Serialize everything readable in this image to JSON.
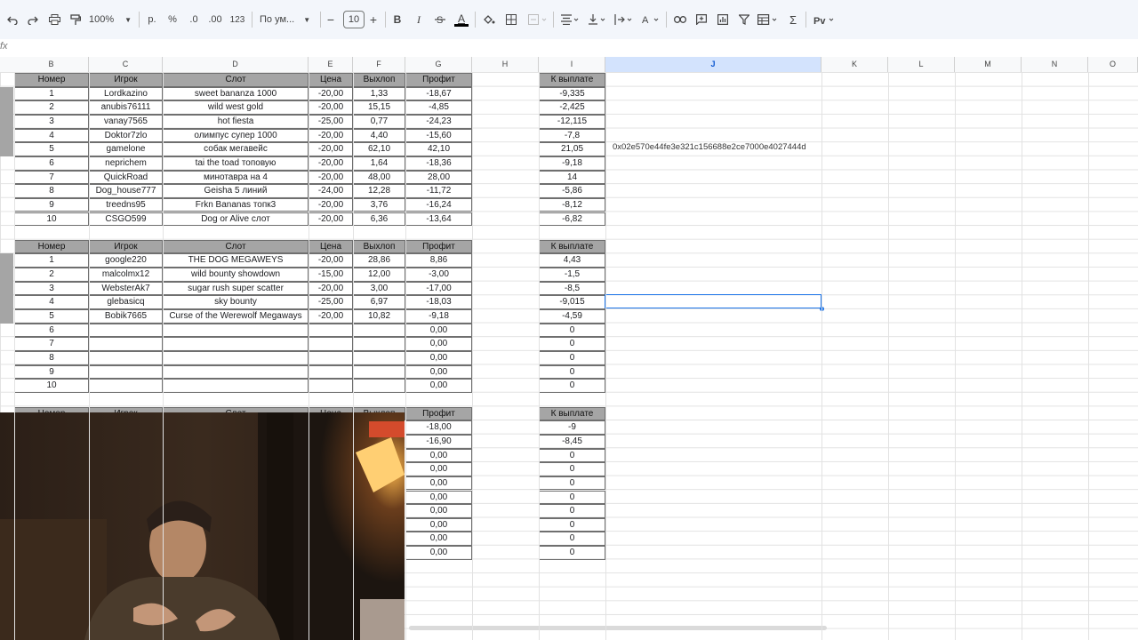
{
  "toolbar": {
    "zoom": "100%",
    "currency": "р.",
    "percent": "%",
    "dec_decrease": ".0",
    "dec_increase": ".00",
    "number_format": "123",
    "font": "По ум...",
    "font_size": "10",
    "minus": "−",
    "plus": "+",
    "bold": "B",
    "italic": "I",
    "text_color_letter": "A"
  },
  "formula_bar": {
    "fx": "fx",
    "value": ""
  },
  "columns": [
    "B",
    "C",
    "D",
    "E",
    "F",
    "G",
    "H",
    "I",
    "J",
    "K",
    "L",
    "M",
    "N",
    "O"
  ],
  "selected_column": "J",
  "wallet_address": "0x02e570e44fe3e321c156688e2ce7000e4027444d",
  "headers": {
    "num": "Номер",
    "player": "Игрок",
    "slot": "Слот",
    "price": "Цена",
    "payout": "Выхлоп",
    "profit": "Профит",
    "to_pay": "К выплате"
  },
  "table1": [
    {
      "n": "1",
      "player": "Lordkazino",
      "slot": "sweet bananza 1000",
      "price": "-20,00",
      "payout": "1,33",
      "profit": "-18,67",
      "pay": "-9,335"
    },
    {
      "n": "2",
      "player": "anubis76111",
      "slot": "wild west gold",
      "price": "-20,00",
      "payout": "15,15",
      "profit": "-4,85",
      "pay": "-2,425"
    },
    {
      "n": "3",
      "player": "vanay7565",
      "slot": "hot fiesta",
      "price": "-25,00",
      "payout": "0,77",
      "profit": "-24,23",
      "pay": "-12,115"
    },
    {
      "n": "4",
      "player": "Doktor7zlo",
      "slot": "олимпус супер 1000",
      "price": "-20,00",
      "payout": "4,40",
      "profit": "-15,60",
      "pay": "-7,8"
    },
    {
      "n": "5",
      "player": "gamelone",
      "slot": "собак мегавейс",
      "price": "-20,00",
      "payout": "62,10",
      "profit": "42,10",
      "pay": "21,05"
    },
    {
      "n": "6",
      "player": "neprichem",
      "slot": "tai the toad топовую",
      "price": "-20,00",
      "payout": "1,64",
      "profit": "-18,36",
      "pay": "-9,18"
    },
    {
      "n": "7",
      "player": "QuickRoad",
      "slot": "минотавра на 4",
      "price": "-20,00",
      "payout": "48,00",
      "profit": "28,00",
      "pay": "14"
    },
    {
      "n": "8",
      "player": "Dog_house777",
      "slot": "Geisha 5 линий",
      "price": "-24,00",
      "payout": "12,28",
      "profit": "-11,72",
      "pay": "-5,86"
    },
    {
      "n": "9",
      "player": "treedns95",
      "slot": "Frkn Bananas топк3",
      "price": "-20,00",
      "payout": "3,76",
      "profit": "-16,24",
      "pay": "-8,12"
    },
    {
      "n": "10",
      "player": "CSGO599",
      "slot": "Dog or Alive слот",
      "price": "-20,00",
      "payout": "6,36",
      "profit": "-13,64",
      "pay": "-6,82"
    }
  ],
  "table2": [
    {
      "n": "1",
      "player": "google220",
      "slot": "THE DOG MEGAWEYS",
      "price": "-20,00",
      "payout": "28,86",
      "profit": "8,86",
      "pay": "4,43"
    },
    {
      "n": "2",
      "player": "malcolmx12",
      "slot": "wild bounty showdown",
      "price": "-15,00",
      "payout": "12,00",
      "profit": "-3,00",
      "pay": "-1,5"
    },
    {
      "n": "3",
      "player": "WebsterAk7",
      "slot": "sugar rush super scatter",
      "price": "-20,00",
      "payout": "3,00",
      "profit": "-17,00",
      "pay": "-8,5"
    },
    {
      "n": "4",
      "player": "glebasicq",
      "slot": "sky bounty",
      "price": "-25,00",
      "payout": "6,97",
      "profit": "-18,03",
      "pay": "-9,015"
    },
    {
      "n": "5",
      "player": "Bobik7665",
      "slot": "Curse of the Werewolf Megaways",
      "price": "-20,00",
      "payout": "10,82",
      "profit": "-9,18",
      "pay": "-4,59"
    },
    {
      "n": "6",
      "player": "",
      "slot": "",
      "price": "",
      "payout": "",
      "profit": "0,00",
      "pay": "0"
    },
    {
      "n": "7",
      "player": "",
      "slot": "",
      "price": "",
      "payout": "",
      "profit": "0,00",
      "pay": "0"
    },
    {
      "n": "8",
      "player": "",
      "slot": "",
      "price": "",
      "payout": "",
      "profit": "0,00",
      "pay": "0"
    },
    {
      "n": "9",
      "player": "",
      "slot": "",
      "price": "",
      "payout": "",
      "profit": "0,00",
      "pay": "0"
    },
    {
      "n": "10",
      "player": "",
      "slot": "",
      "price": "",
      "payout": "",
      "profit": "0,00",
      "pay": "0"
    }
  ],
  "table3": [
    {
      "profit": "-18,00",
      "pay": "-9"
    },
    {
      "profit": "-16,90",
      "pay": "-8,45"
    },
    {
      "profit": "0,00",
      "pay": "0"
    },
    {
      "profit": "0,00",
      "pay": "0"
    },
    {
      "profit": "0,00",
      "pay": "0"
    },
    {
      "profit": "0,00",
      "pay": "0"
    },
    {
      "profit": "0,00",
      "pay": "0"
    },
    {
      "profit": "0,00",
      "pay": "0"
    },
    {
      "profit": "0,00",
      "pay": "0"
    },
    {
      "profit": "0,00",
      "pay": "0"
    }
  ]
}
